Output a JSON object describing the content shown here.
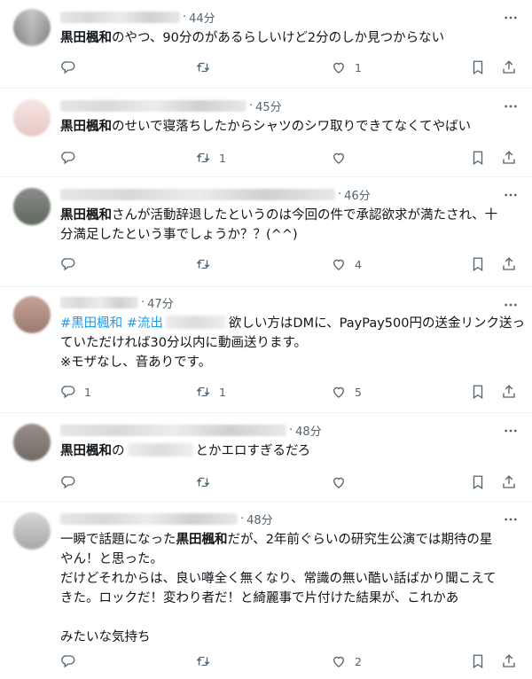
{
  "tweets": [
    {
      "time": "44分",
      "segments": [
        [
          {
            "t": "黒田楓和",
            "b": true
          },
          {
            "t": "のやつ、90分のがあるらしいけど2分のしか見つからない"
          }
        ]
      ],
      "reply_count": "",
      "retweet_count": "",
      "like_count": "1"
    },
    {
      "time": "45分",
      "segments": [
        [
          {
            "t": "黒田楓和",
            "b": true
          },
          {
            "t": "のせいで寝落ちしたからシャツのシワ取りできてなくてやばい"
          }
        ]
      ],
      "reply_count": "",
      "retweet_count": "1",
      "like_count": ""
    },
    {
      "time": "46分",
      "segments": [
        [
          {
            "t": "黒田楓和",
            "b": true
          },
          {
            "t": "さんが活動辞退したというのは今回の件で承認欲求が満たされ、十"
          }
        ],
        [
          {
            "t": "分満足したという事でしょうか？？(^^)"
          }
        ]
      ],
      "reply_count": "",
      "retweet_count": "",
      "like_count": "4"
    },
    {
      "time": "47分",
      "segments": [
        [
          {
            "t": "#黒田楓和",
            "h": true
          },
          {
            "t": " "
          },
          {
            "t": "#流出",
            "h": true
          },
          {
            "t": "REDACT"
          },
          {
            "t": "欲しい方はDMに、PayPay500円の送金リンク送っ"
          }
        ],
        [
          {
            "t": "ていただければ30分以内に動画送ります。"
          }
        ],
        [
          {
            "t": "※モザなし、音ありです。"
          }
        ]
      ],
      "reply_count": "1",
      "retweet_count": "1",
      "like_count": "5"
    },
    {
      "time": "48分",
      "segments": [
        [
          {
            "t": "黒田楓和",
            "b": true
          },
          {
            "t": "の"
          },
          {
            "t": "REDACT"
          },
          {
            "t": "とかエロすぎるだろ"
          }
        ]
      ],
      "reply_count": "",
      "retweet_count": "",
      "like_count": ""
    },
    {
      "time": "48分",
      "segments": [
        [
          {
            "t": "一瞬で話題になった"
          },
          {
            "t": "黒田楓和",
            "b": true
          },
          {
            "t": "だが、2年前ぐらいの研究生公演では期待の星"
          }
        ],
        [
          {
            "t": "やん！と思った。"
          }
        ],
        [
          {
            "t": "だけどそれからは、良い噂全く無くなり、常識の無い酷い話ばかり聞こえて"
          }
        ],
        [
          {
            "t": "きた。ロックだ！変わり者だ！と綺麗事で片付けた結果が、これかあ"
          }
        ],
        [
          {
            "t": ""
          }
        ],
        [
          {
            "t": "みたいな気持ち"
          }
        ]
      ],
      "reply_count": "",
      "retweet_count": "",
      "like_count": "2"
    }
  ],
  "icons": [
    "more-icon",
    "reply-icon",
    "retweet-icon",
    "like-icon",
    "views-icon",
    "bookmark-icon",
    "share-icon"
  ],
  "colors": {
    "accent": "#1d9bf0",
    "muted": "#536471",
    "text": "#0f1419",
    "divider": "#eff3f4"
  }
}
